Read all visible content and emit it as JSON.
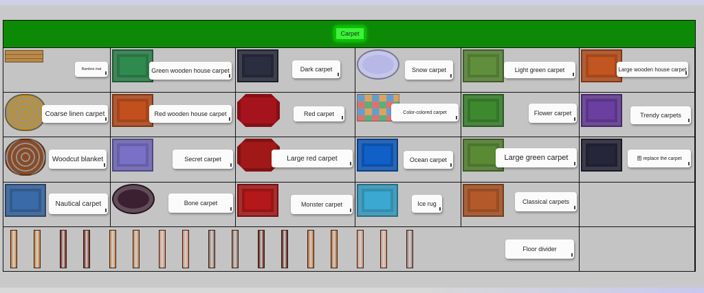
{
  "header": {
    "tab_label": "Carpet"
  },
  "rows": [
    [
      {
        "label": "Bamboo mat",
        "rug": {
          "kind": "mat",
          "color": "#b88a4a"
        }
      },
      {
        "label": "Green wooden house carpet",
        "rug": {
          "kind": "rect",
          "color": "#2f8a50"
        }
      },
      {
        "label": "Dark carpet",
        "rug": {
          "kind": "rect",
          "color": "#2b2d40"
        }
      },
      {
        "label": "Snow carpet",
        "rug": {
          "kind": "oval",
          "color": "#b8b8e6"
        }
      },
      {
        "label": "Light green carpet",
        "rug": {
          "kind": "rect",
          "color": "#5f8f3a"
        }
      },
      {
        "label": "Large wooden house carpet",
        "rug": {
          "kind": "rect",
          "color": "#c25520"
        }
      }
    ],
    [
      {
        "label": "Coarse linen carpet",
        "rug": {
          "kind": "round",
          "color": "#b8913a"
        }
      },
      {
        "label": "Red wooden house carpet",
        "rug": {
          "kind": "rect",
          "color": "#c2501e"
        }
      },
      {
        "label": "Red carpet",
        "rug": {
          "kind": "oct",
          "color": "#a5141c"
        }
      },
      {
        "label": "Color-colored carpet",
        "rug": {
          "kind": "grid",
          "color": "#58b07a"
        }
      },
      {
        "label": "Flower carpet",
        "rug": {
          "kind": "rect",
          "color": "#3d8a2e"
        }
      },
      {
        "label": "Trendy carpets",
        "rug": {
          "kind": "rect",
          "color": "#6a3fa0"
        }
      }
    ],
    [
      {
        "label": "Woodcut blanket",
        "rug": {
          "kind": "round",
          "color": "#8a4a26"
        }
      },
      {
        "label": "Secret carpet",
        "rug": {
          "kind": "rect",
          "color": "#7a70c8"
        }
      },
      {
        "label": "Large red carpet",
        "rug": {
          "kind": "oct",
          "color": "#a01818"
        }
      },
      {
        "label": "Ocean carpet",
        "rug": {
          "kind": "rect",
          "color": "#1060c8"
        }
      },
      {
        "label": "Large green carpet",
        "rug": {
          "kind": "rect",
          "color": "#5a8a34"
        }
      },
      {
        "label": "图 replace the carpet",
        "rug": {
          "kind": "rect",
          "color": "#26263a"
        }
      }
    ],
    [
      {
        "label": "Nautical carpet",
        "rug": {
          "kind": "rect",
          "color": "#3a6aa8"
        }
      },
      {
        "label": "Bone carpet",
        "rug": {
          "kind": "oval",
          "color": "#3a2030"
        }
      },
      {
        "label": "Monster carpet",
        "rug": {
          "kind": "rect",
          "color": "#b41818"
        }
      },
      {
        "label": "Ice rug",
        "rug": {
          "kind": "rect",
          "color": "#3aa8d0"
        }
      },
      {
        "label": "Classical carpets",
        "rug": {
          "kind": "rect",
          "color": "#b45a28"
        }
      },
      {
        "label": "",
        "rug": null
      }
    ]
  ],
  "floor_divider": {
    "label": "Floor divider",
    "plank_colors": [
      "#c87a2a",
      "#c87a2a",
      "#6a1a14",
      "#6a1a14",
      "#c8824a",
      "#c8824a",
      "#d08a6a",
      "#d08a6a",
      "#8a6a60",
      "#8a6a60",
      "#5a1414",
      "#5a1414",
      "#c06a2a",
      "#c06a2a",
      "#d0907a",
      "#d0907a",
      "#9a7a78"
    ]
  }
}
